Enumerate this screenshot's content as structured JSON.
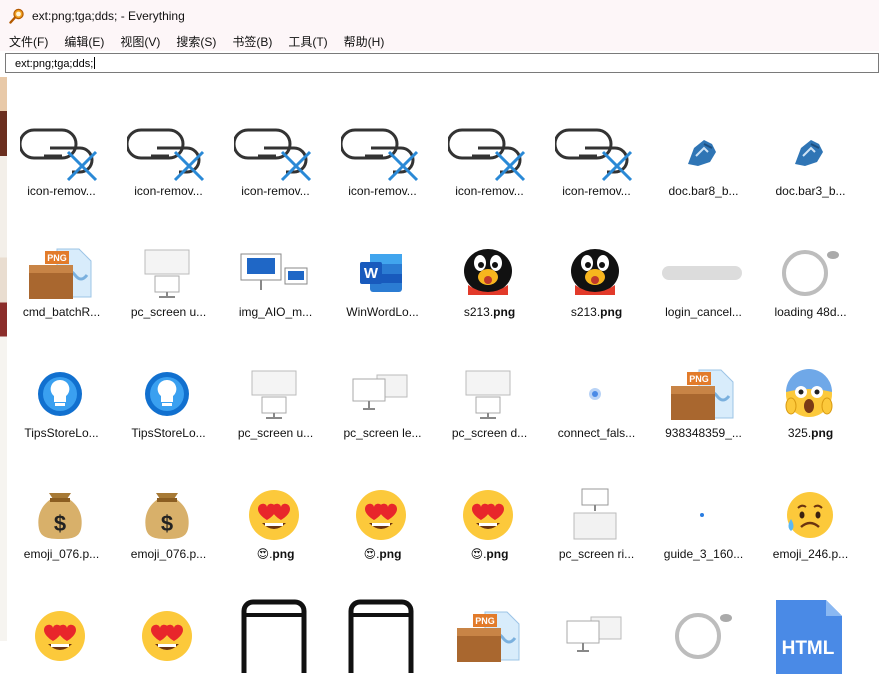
{
  "window": {
    "title": "ext:png;tga;dds; - Everything"
  },
  "menu": [
    "文件(F)",
    "编辑(E)",
    "视图(V)",
    "搜索(S)",
    "书签(B)",
    "工具(T)",
    "帮助(H)"
  ],
  "search": {
    "value": "ext:png;tga;dds;"
  },
  "rows": [
    [
      {
        "label": "icon-remov...",
        "icon": "remove-link-icon"
      },
      {
        "label": "icon-remov...",
        "icon": "remove-link-icon"
      },
      {
        "label": "icon-remov...",
        "icon": "remove-link-icon"
      },
      {
        "label": "icon-remov...",
        "icon": "remove-link-icon"
      },
      {
        "label": "icon-remov...",
        "icon": "remove-link-icon"
      },
      {
        "label": "icon-remov...",
        "icon": "remove-link-icon"
      },
      {
        "label": "doc.bar8_b...",
        "icon": "hand-blue-icon"
      },
      {
        "label": "doc.bar3_b...",
        "icon": "hand-blue-icon"
      }
    ],
    [
      {
        "label": "cmd_batchR...",
        "icon": "png-box-icon"
      },
      {
        "label": "pc_screen u...",
        "icon": "monitor-icon"
      },
      {
        "label": "img_AIO_m...",
        "icon": "two-screens-icon"
      },
      {
        "label": "WinWordLo...",
        "icon": "word-logo-icon"
      },
      {
        "label": "s213.png",
        "icon": "qq-penguin-icon",
        "bold": "png",
        "name": "s213."
      },
      {
        "label": "s213.png",
        "icon": "qq-penguin-icon",
        "bold": "png",
        "name": "s213."
      },
      {
        "label": "login_cancel...",
        "icon": "gray-pill-icon"
      },
      {
        "label": "loading 48d...",
        "icon": "loading-ring-icon"
      }
    ],
    [
      {
        "label": "TipsStoreLo...",
        "icon": "bulb-logo-icon"
      },
      {
        "label": "TipsStoreLo...",
        "icon": "bulb-logo-icon"
      },
      {
        "label": "pc_screen u...",
        "icon": "monitor-icon"
      },
      {
        "label": "pc_screen le...",
        "icon": "dual-monitor-icon"
      },
      {
        "label": "pc_screen d...",
        "icon": "monitor-icon"
      },
      {
        "label": "connect_fals...",
        "icon": "blue-dot-icon"
      },
      {
        "label": "938348359_...",
        "icon": "png-box-icon"
      },
      {
        "label": "325.png",
        "icon": "scream-emoji-icon",
        "bold": "png",
        "name": "325."
      }
    ],
    [
      {
        "label": "emoji_076.p...",
        "icon": "money-bag-icon"
      },
      {
        "label": "emoji_076.p...",
        "icon": "money-bag-icon"
      },
      {
        "label": "😍.png",
        "icon": "heart-eyes-emoji-icon",
        "bold": "png",
        "name": "😍."
      },
      {
        "label": "😍.png",
        "icon": "heart-eyes-emoji-icon",
        "bold": "png",
        "name": "😍."
      },
      {
        "label": "😍.png",
        "icon": "heart-eyes-emoji-icon",
        "bold": "png",
        "name": "😍."
      },
      {
        "label": "pc_screen ri...",
        "icon": "monitor-stack-icon"
      },
      {
        "label": "guide_3_160...",
        "icon": "small-dot-icon"
      },
      {
        "label": "emoji_246.p...",
        "icon": "sad-sweat-emoji-icon"
      }
    ],
    [
      {
        "label": "",
        "icon": "heart-eyes-emoji-icon"
      },
      {
        "label": "",
        "icon": "heart-eyes-emoji-icon"
      },
      {
        "label": "",
        "icon": "phone-outline-icon"
      },
      {
        "label": "",
        "icon": "phone-outline-icon"
      },
      {
        "label": "",
        "icon": "png-box-icon"
      },
      {
        "label": "",
        "icon": "dual-monitor-icon"
      },
      {
        "label": "",
        "icon": "loading-ring-icon"
      },
      {
        "label": "HTML",
        "icon": "html-file-icon"
      }
    ]
  ],
  "colors": {
    "accent": "#1e7ad4",
    "chrome": "#fdf6f8"
  }
}
